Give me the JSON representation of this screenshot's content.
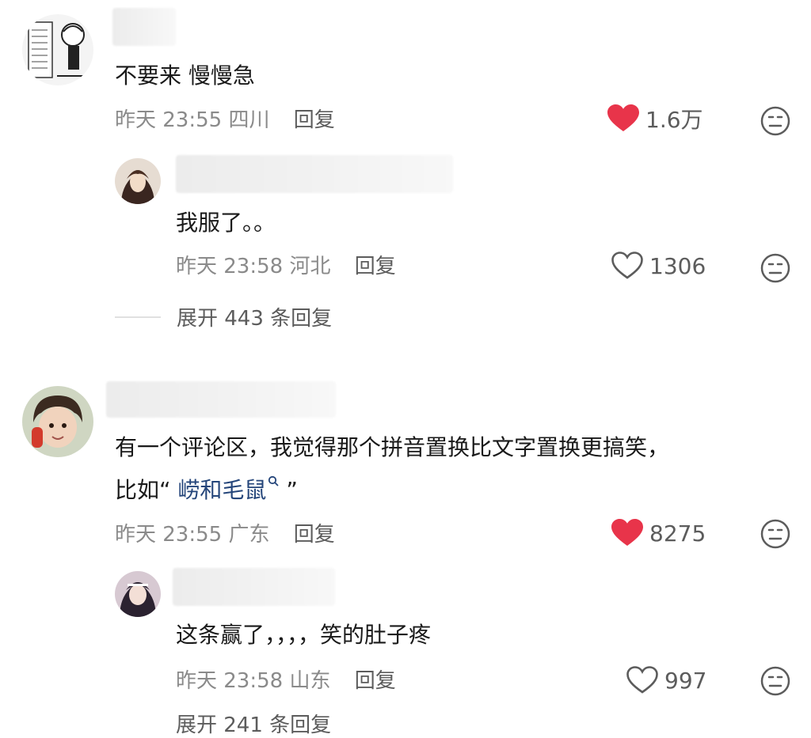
{
  "comments": [
    {
      "text": "不要来 慢慢急",
      "meta": {
        "time": "昨天 23:55",
        "location": "四川",
        "reply": "回复"
      },
      "likes": "1.6万",
      "liked": true,
      "replies": [
        {
          "text": "我服了。。",
          "meta": {
            "time": "昨天 23:58",
            "location": "河北",
            "reply": "回复"
          },
          "likes": "1306",
          "liked": false
        }
      ],
      "expand": "展开 443 条回复"
    },
    {
      "text_line1": "有一个评论区，我觉得那个拼音置换比文字置换更搞笑，",
      "text_line2_prefix": "比如“ ",
      "text_line2_link": "崂和毛鼠",
      "text_line2_suffix": " ”",
      "meta": {
        "time": "昨天 23:55",
        "location": "广东",
        "reply": "回复"
      },
      "likes": "8275",
      "liked": true,
      "replies": [
        {
          "text": "这条赢了，，，，笑的肚子疼",
          "meta": {
            "time": "昨天 23:58",
            "location": "山东",
            "reply": "回复"
          },
          "likes": "997",
          "liked": false
        }
      ],
      "expand": "展开 241 条回复"
    }
  ],
  "colors": {
    "heart_filled": "#e8344a",
    "meta_gray": "#8a8a8a",
    "link": "#24457a"
  },
  "icons": [
    "heart-filled-icon",
    "heart-outline-icon",
    "dislike-face-icon",
    "search-icon"
  ]
}
